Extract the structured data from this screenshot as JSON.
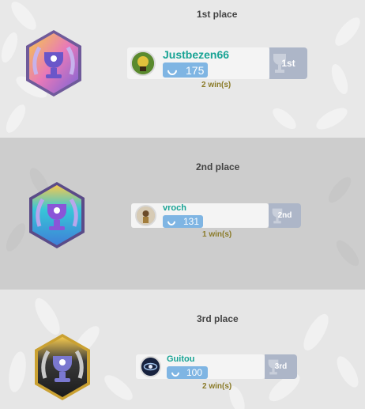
{
  "podium": [
    {
      "place_label": "1st place",
      "player": "Justbezen66",
      "points": "175",
      "rank_tag": "1st",
      "wins": "2 win(s)",
      "medal": "gold-trophy-medal-icon"
    },
    {
      "place_label": "2nd place",
      "player": "vroch",
      "points": "131",
      "rank_tag": "2nd",
      "wins": "1 win(s)",
      "medal": "silver-trophy-medal-icon"
    },
    {
      "place_label": "3rd place",
      "player": "Guitou",
      "points": "100",
      "rank_tag": "3rd",
      "wins": "2 win(s)",
      "medal": "bronze-trophy-medal-icon"
    }
  ],
  "colors": {
    "name": "#17a394",
    "points_badge": "#7fb5e3",
    "rank_tag": "#adb6c8",
    "wins": "#8a7a27"
  }
}
